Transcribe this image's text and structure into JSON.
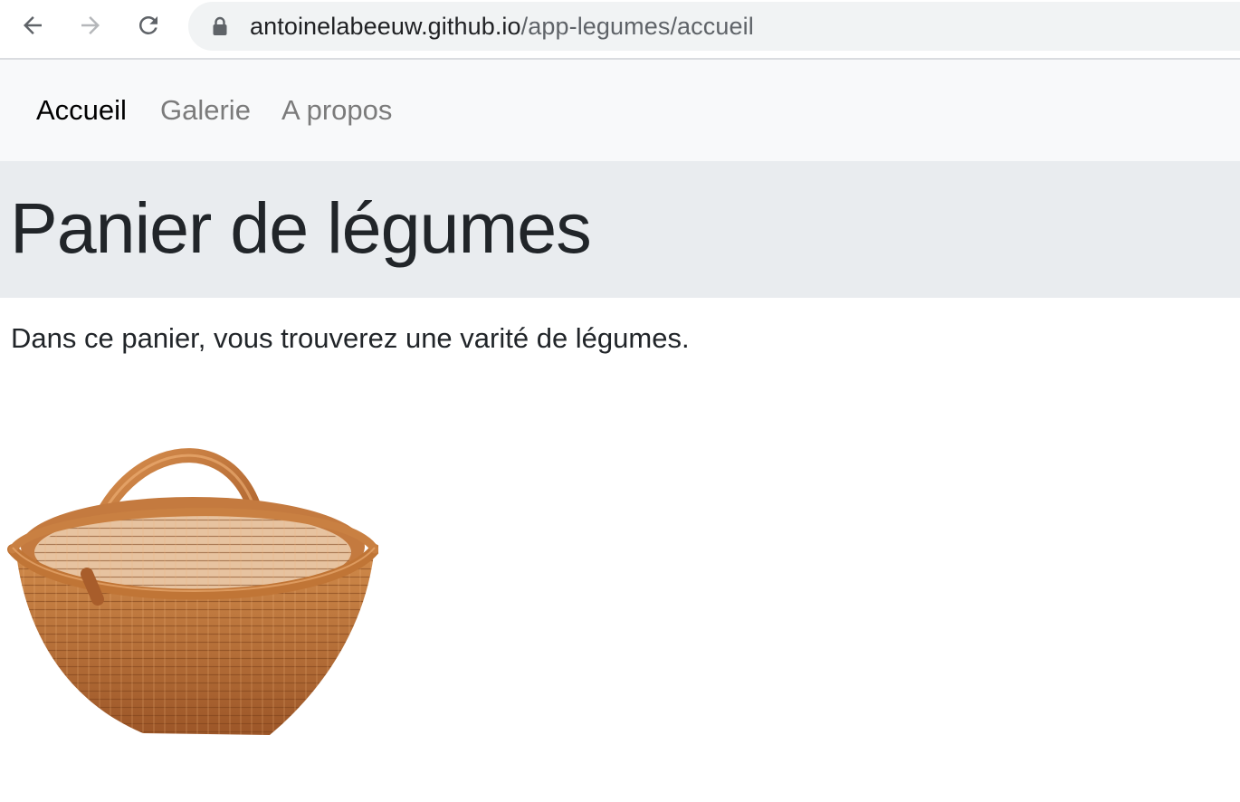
{
  "browser": {
    "url_host": "antoinelabeeuw.github.io",
    "url_path": "/app-legumes/accueil",
    "icons": [
      "back-arrow-icon",
      "forward-arrow-icon",
      "reload-icon",
      "lock-icon"
    ]
  },
  "navbar": {
    "items": [
      {
        "label": "Accueil",
        "active": true
      },
      {
        "label": "Galerie",
        "active": false
      },
      {
        "label": "A propos",
        "active": false
      }
    ]
  },
  "main": {
    "title": "Panier de légumes",
    "description": "Dans ce panier, vous trouverez une varité de légumes.",
    "image": "wicker-basket"
  },
  "colors": {
    "navbar_bg": "#f8f9fa",
    "jumbotron_bg": "#e9ecef",
    "text": "#212529",
    "muted_link": "#7b7b7b",
    "omnibox_bg": "#f1f3f4"
  }
}
